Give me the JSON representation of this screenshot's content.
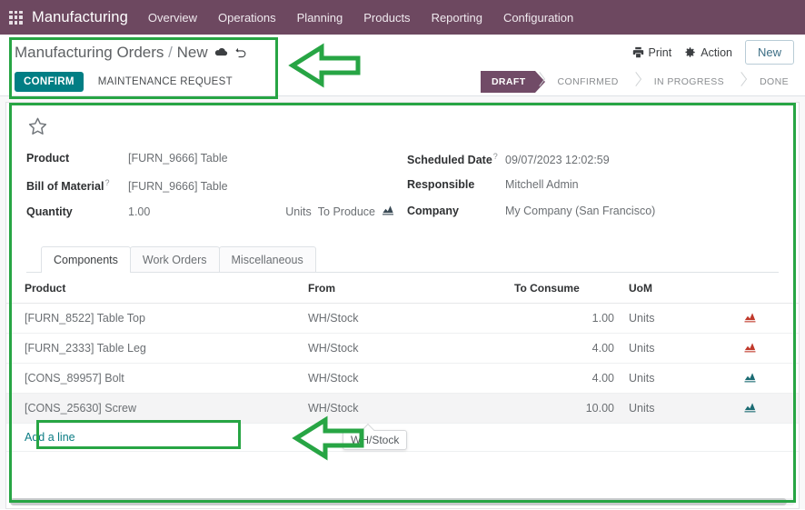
{
  "navbar": {
    "apps_icon": "apps-grid-icon",
    "app_name": "Manufacturing",
    "menus": [
      "Overview",
      "Operations",
      "Planning",
      "Products",
      "Reporting",
      "Configuration"
    ],
    "bg_color": "#6d4860"
  },
  "control_panel": {
    "breadcrumb_root": "Manufacturing Orders",
    "breadcrumb_sep": "/",
    "breadcrumb_current": "New",
    "save_icon": "cloud-save-icon",
    "discard_icon": "discard-undo-icon",
    "print_label": "Print",
    "print_icon": "printer-icon",
    "action_label": "Action",
    "action_icon": "gear-icon",
    "new_label": "New",
    "confirm_label": "CONFIRM",
    "maintenance_label": "MAINTENANCE REQUEST",
    "confirm_color": "#017e84"
  },
  "statusbar": {
    "stages": [
      "DRAFT",
      "CONFIRMED",
      "IN PROGRESS",
      "DONE"
    ],
    "active": "DRAFT",
    "active_color": "#714b67"
  },
  "form": {
    "priority_icon": "star-icon",
    "left_fields": [
      {
        "label": "Product",
        "help": false,
        "value": "[FURN_9666] Table"
      },
      {
        "label": "Bill of Material",
        "help": true,
        "value": "[FURN_9666] Table"
      },
      {
        "label": "Quantity",
        "help": false,
        "value": "1.00",
        "unit": "Units"
      }
    ],
    "to_produce_label": "To Produce",
    "to_produce_icon": "forecast-chart-icon",
    "right_fields": [
      {
        "label": "Scheduled Date",
        "help": true,
        "value": "09/07/2023 12:02:59"
      },
      {
        "label": "Responsible",
        "help": false,
        "value": "Mitchell Admin"
      },
      {
        "label": "Company",
        "help": false,
        "value": "My Company (San Francisco)"
      }
    ]
  },
  "notebook": {
    "tabs": [
      {
        "label": "Components",
        "active": true
      },
      {
        "label": "Work Orders",
        "active": false
      },
      {
        "label": "Miscellaneous",
        "active": false
      }
    ],
    "columns": [
      "Product",
      "From",
      "To Consume",
      "UoM"
    ],
    "optional_columns_icon": "column-options-icon",
    "rows": [
      {
        "product": "[FURN_8522] Table Top",
        "from": "WH/Stock",
        "to_consume": "1.00",
        "uom": "Units",
        "forecast_icon": "forecast-chart-icon",
        "forecast_color": "#c0392b",
        "delete_icon": "trash-icon",
        "hovered": false
      },
      {
        "product": "[FURN_2333] Table Leg",
        "from": "WH/Stock",
        "to_consume": "4.00",
        "uom": "Units",
        "forecast_icon": "forecast-chart-icon",
        "forecast_color": "#c0392b",
        "delete_icon": "trash-icon",
        "hovered": false
      },
      {
        "product": "[CONS_89957] Bolt",
        "from": "WH/Stock",
        "to_consume": "4.00",
        "uom": "Units",
        "forecast_icon": "forecast-chart-icon",
        "forecast_color": "#1b6b73",
        "delete_icon": "trash-icon",
        "hovered": false
      },
      {
        "product": "[CONS_25630] Screw",
        "from": "WH/Stock",
        "to_consume": "10.00",
        "uom": "Units",
        "forecast_icon": "forecast-chart-icon",
        "forecast_color": "#1b6b73",
        "delete_icon": "trash-icon",
        "hovered": true
      }
    ],
    "add_line_label": "Add a line"
  },
  "tooltip": {
    "text": "WH/Stock"
  },
  "annotations": {
    "color": "#27a544",
    "arrow_top_label": "pointer-to-breadcrumb-actions",
    "arrow_bottom_label": "pointer-to-add-a-line"
  }
}
